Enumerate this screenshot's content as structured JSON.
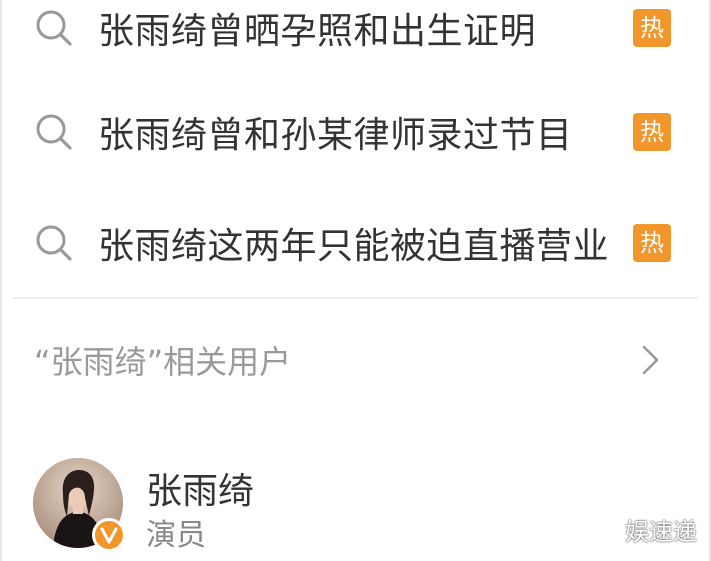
{
  "suggestions": [
    {
      "text": "张雨绮曾晒孕照和出生证明",
      "badge": "热"
    },
    {
      "text": "张雨绮曾和孙某律师录过节目",
      "badge": "热"
    },
    {
      "text": "张雨绮这两年只能被迫直播营业",
      "badge": "热"
    }
  ],
  "related_users": {
    "title": "“张雨绮”相关用户"
  },
  "user": {
    "name": "张雨绮",
    "role": "演员"
  },
  "watermark": "娱速递",
  "colors": {
    "hot_badge": "#f0962b",
    "verified_badge": "#f0962b",
    "text_primary": "#333333",
    "text_secondary": "#9a9a9a"
  }
}
